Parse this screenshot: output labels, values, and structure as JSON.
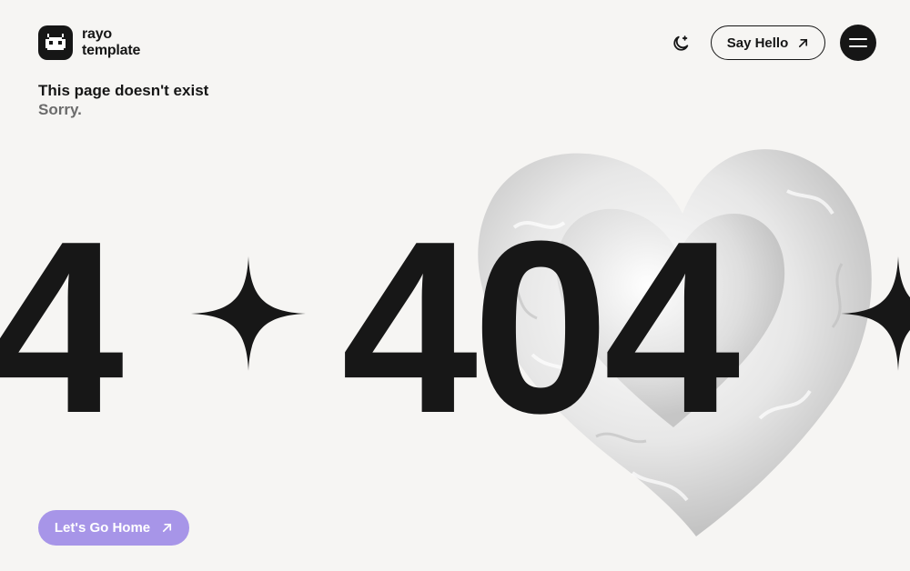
{
  "brand": {
    "line1": "rayo",
    "line2": "template"
  },
  "message": {
    "title": "This page doesn't exist",
    "subtitle": "Sorry."
  },
  "header": {
    "say_hello_label": "Say Hello"
  },
  "hero": {
    "partial_digit": "4",
    "code": "404"
  },
  "cta": {
    "home_label": "Let's Go Home"
  },
  "icons": {
    "logo": "pixel-cat-icon",
    "theme": "moon-sparkle-icon",
    "say_hello_arrow": "arrow-up-right-icon",
    "menu": "hamburger-menu-icon",
    "sparkle": "four-point-star-icon",
    "home_arrow": "arrow-up-right-icon"
  },
  "colors": {
    "background": "#f6f5f3",
    "text": "#161616",
    "accent": "#a795e8",
    "muted": "#6b6b6b"
  }
}
